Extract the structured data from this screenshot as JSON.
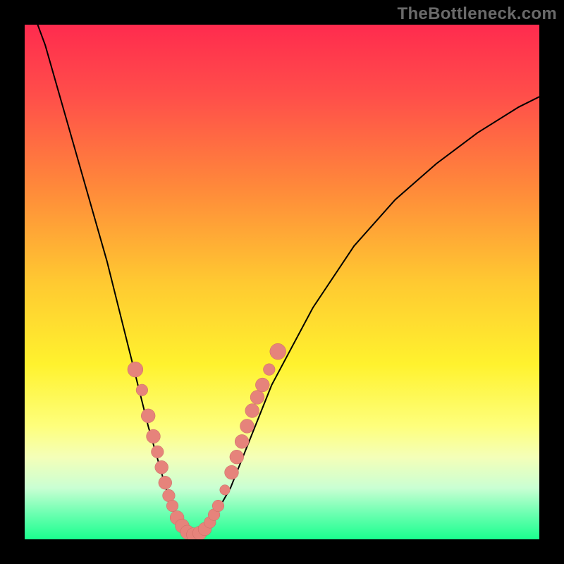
{
  "watermark": "TheBottleneck.com",
  "colors": {
    "frame": "#000000",
    "curve": "#000000",
    "marker_fill": "#e6837b",
    "marker_stroke": "#c96a63"
  },
  "chart_data": {
    "type": "line",
    "title": "",
    "xlabel": "",
    "ylabel": "",
    "xlim": [
      0,
      100
    ],
    "ylim": [
      0,
      100
    ],
    "grid": false,
    "legend": false,
    "series": [
      {
        "name": "bottleneck-curve",
        "x": [
          0,
          4,
          8,
          12,
          16,
          20,
          22,
          24,
          26,
          28,
          30,
          32,
          34,
          36,
          40,
          44,
          48,
          56,
          64,
          72,
          80,
          88,
          96,
          100
        ],
        "y": [
          110,
          96,
          82,
          68,
          54,
          38,
          30,
          22,
          15,
          8,
          3,
          1,
          1,
          3,
          10,
          20,
          30,
          45,
          57,
          66,
          73,
          79,
          84,
          86
        ]
      }
    ],
    "markers": [
      {
        "x": 21.5,
        "y": 33,
        "r": 2.1
      },
      {
        "x": 22.8,
        "y": 29,
        "r": 1.6
      },
      {
        "x": 24.0,
        "y": 24,
        "r": 1.9
      },
      {
        "x": 25.0,
        "y": 20,
        "r": 1.9
      },
      {
        "x": 25.8,
        "y": 17,
        "r": 1.7
      },
      {
        "x": 26.6,
        "y": 14,
        "r": 1.8
      },
      {
        "x": 27.3,
        "y": 11,
        "r": 1.8
      },
      {
        "x": 28.0,
        "y": 8.5,
        "r": 1.7
      },
      {
        "x": 28.7,
        "y": 6.5,
        "r": 1.6
      },
      {
        "x": 29.6,
        "y": 4.2,
        "r": 1.9
      },
      {
        "x": 30.6,
        "y": 2.6,
        "r": 1.9
      },
      {
        "x": 31.6,
        "y": 1.4,
        "r": 1.9
      },
      {
        "x": 32.8,
        "y": 0.9,
        "r": 1.9
      },
      {
        "x": 34.0,
        "y": 1.2,
        "r": 1.9
      },
      {
        "x": 35.0,
        "y": 2.0,
        "r": 1.8
      },
      {
        "x": 36.0,
        "y": 3.3,
        "r": 1.6
      },
      {
        "x": 36.8,
        "y": 4.8,
        "r": 1.6
      },
      {
        "x": 37.6,
        "y": 6.5,
        "r": 1.6
      },
      {
        "x": 38.9,
        "y": 9.6,
        "r": 1.4
      },
      {
        "x": 40.2,
        "y": 13.0,
        "r": 1.9
      },
      {
        "x": 41.2,
        "y": 16.0,
        "r": 1.9
      },
      {
        "x": 42.2,
        "y": 19.0,
        "r": 1.9
      },
      {
        "x": 43.2,
        "y": 22.0,
        "r": 1.9
      },
      {
        "x": 44.2,
        "y": 25.0,
        "r": 1.9
      },
      {
        "x": 45.2,
        "y": 27.6,
        "r": 1.9
      },
      {
        "x": 46.2,
        "y": 30.0,
        "r": 1.9
      },
      {
        "x": 47.5,
        "y": 33.0,
        "r": 1.6
      },
      {
        "x": 49.2,
        "y": 36.5,
        "r": 2.2
      }
    ]
  }
}
